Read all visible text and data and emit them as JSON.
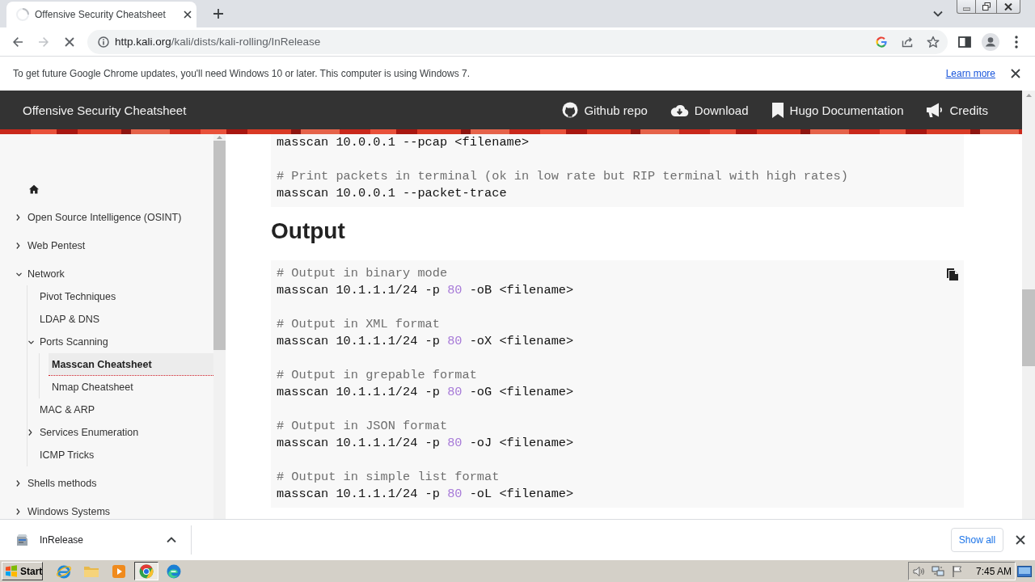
{
  "browser": {
    "tab": {
      "title": "Offensive Security Cheatsheet"
    },
    "nav_buttons": [
      {
        "kind": "back",
        "disabled": false
      },
      {
        "kind": "forward",
        "disabled": true
      },
      {
        "kind": "stop",
        "disabled": false
      }
    ],
    "address": {
      "host": "http.kali.org",
      "path": "/kali/dists/kali-rolling/InRelease"
    }
  },
  "infobar": {
    "message": "To get future Google Chrome updates, you'll need Windows 10 or later. This computer is using Windows 7.",
    "link": "Learn more"
  },
  "site_header": {
    "title": "Offensive Security Cheatsheet",
    "links": [
      {
        "kind": "github",
        "label": "Github repo"
      },
      {
        "kind": "download",
        "label": "Download"
      },
      {
        "kind": "bookmark",
        "label": "Hugo Documentation"
      },
      {
        "kind": "megaphone",
        "label": "Credits"
      }
    ]
  },
  "sidebar": {
    "items": [
      {
        "kind": "folder",
        "label": "Open Source Intelligence (OSINT)",
        "expanded": false,
        "selected": false
      },
      {
        "kind": "folder",
        "label": "Web Pentest",
        "expanded": false,
        "selected": false
      },
      {
        "kind": "folder",
        "label": "Network",
        "expanded": true,
        "selected": false,
        "children": [
          {
            "kind": "page",
            "label": "Pivot Techniques",
            "selected": false
          },
          {
            "kind": "page",
            "label": "LDAP & DNS",
            "selected": false
          },
          {
            "kind": "folder",
            "label": "Ports Scanning",
            "expanded": true,
            "selected": false,
            "children": [
              {
                "kind": "page",
                "label": "Masscan Cheatsheet",
                "selected": true
              },
              {
                "kind": "page",
                "label": "Nmap Cheatsheet",
                "selected": false
              }
            ]
          },
          {
            "kind": "page",
            "label": "MAC & ARP",
            "selected": false
          },
          {
            "kind": "folder",
            "label": "Services Enumeration",
            "expanded": false,
            "selected": false
          },
          {
            "kind": "page",
            "label": "ICMP Tricks",
            "selected": false
          }
        ]
      },
      {
        "kind": "folder",
        "label": "Shells methods",
        "expanded": false,
        "selected": false
      },
      {
        "kind": "folder",
        "label": "Windows Systems",
        "expanded": false,
        "selected": false
      }
    ]
  },
  "content": {
    "blocks": [
      {
        "kind": "code",
        "lines": [
          {
            "kind": "command",
            "tokens": [
              {
                "kind": "plain",
                "text": "masscan 10.0.0.1 --pcap <filename>"
              }
            ]
          },
          {
            "kind": "blank"
          },
          {
            "kind": "comment",
            "text": "# Print packets in terminal (ok in low rate but RIP terminal with high rates)"
          },
          {
            "kind": "command",
            "tokens": [
              {
                "kind": "plain",
                "text": "masscan 10.0.0.1 --packet-trace"
              }
            ]
          }
        ]
      },
      {
        "kind": "heading",
        "text": "Output"
      },
      {
        "kind": "code",
        "copy_button": true,
        "lines": [
          {
            "kind": "comment",
            "text": "# Output in binary mode"
          },
          {
            "kind": "command",
            "tokens": [
              {
                "kind": "plain",
                "text": "masscan 10.1.1.1/24 -p "
              },
              {
                "kind": "number",
                "text": "80"
              },
              {
                "kind": "plain",
                "text": " -oB <filename>"
              }
            ]
          },
          {
            "kind": "blank"
          },
          {
            "kind": "comment",
            "text": "# Output in XML format"
          },
          {
            "kind": "command",
            "tokens": [
              {
                "kind": "plain",
                "text": "masscan 10.1.1.1/24 -p "
              },
              {
                "kind": "number",
                "text": "80"
              },
              {
                "kind": "plain",
                "text": " -oX <filename>"
              }
            ]
          },
          {
            "kind": "blank"
          },
          {
            "kind": "comment",
            "text": "# Output in grepable format"
          },
          {
            "kind": "command",
            "tokens": [
              {
                "kind": "plain",
                "text": "masscan 10.1.1.1/24 -p "
              },
              {
                "kind": "number",
                "text": "80"
              },
              {
                "kind": "plain",
                "text": " -oG <filename>"
              }
            ]
          },
          {
            "kind": "blank"
          },
          {
            "kind": "comment",
            "text": "# Output in JSON format"
          },
          {
            "kind": "command",
            "tokens": [
              {
                "kind": "plain",
                "text": "masscan 10.1.1.1/24 -p "
              },
              {
                "kind": "number",
                "text": "80"
              },
              {
                "kind": "plain",
                "text": " -oJ <filename>"
              }
            ]
          },
          {
            "kind": "blank"
          },
          {
            "kind": "comment",
            "text": "# Output in simple list format"
          },
          {
            "kind": "command",
            "tokens": [
              {
                "kind": "plain",
                "text": "masscan 10.1.1.1/24 -p "
              },
              {
                "kind": "number",
                "text": "80"
              },
              {
                "kind": "plain",
                "text": " -oL <filename>"
              }
            ]
          }
        ]
      }
    ]
  },
  "download_bar": {
    "file": "InRelease",
    "button": "Show all"
  },
  "taskbar": {
    "start": "Start",
    "apps": [
      {
        "kind": "ie",
        "selected": false
      },
      {
        "kind": "folder",
        "selected": false
      },
      {
        "kind": "media",
        "selected": false
      },
      {
        "kind": "chrome",
        "selected": true
      },
      {
        "kind": "edge",
        "selected": false
      }
    ],
    "clock": "7:45 AM"
  }
}
